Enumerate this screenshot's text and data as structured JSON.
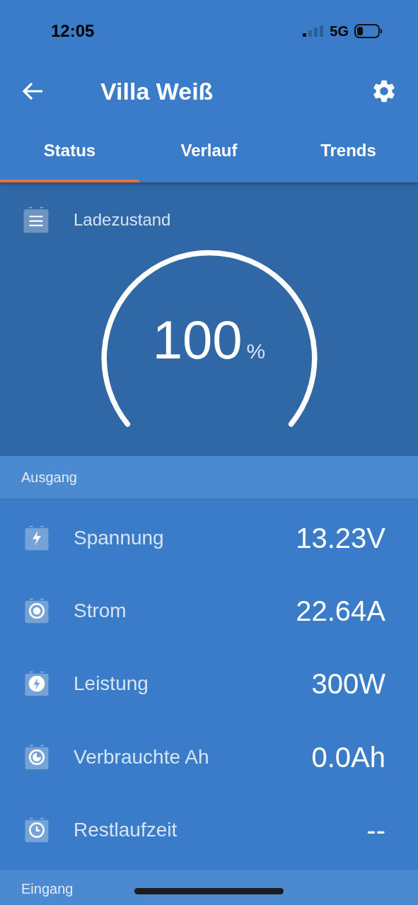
{
  "status_bar": {
    "time": "12:05",
    "network": "5G"
  },
  "header": {
    "title": "Villa Weiß"
  },
  "tabs": [
    {
      "label": "Status",
      "selected": true
    },
    {
      "label": "Verlauf",
      "selected": false
    },
    {
      "label": "Trends",
      "selected": false
    }
  ],
  "gauge": {
    "label": "Ladezustand",
    "value": "100",
    "unit": "%"
  },
  "sections": [
    {
      "title": "Ausgang",
      "rows": [
        {
          "kind": "voltage",
          "label": "Spannung",
          "value": "13.23V"
        },
        {
          "kind": "current",
          "label": "Strom",
          "value": "22.64A"
        },
        {
          "kind": "power",
          "label": "Leistung",
          "value": "300W"
        },
        {
          "kind": "consumed",
          "label": "Verbrauchte Ah",
          "value": "0.0Ah"
        },
        {
          "kind": "time",
          "label": "Restlaufzeit",
          "value": "--"
        }
      ]
    },
    {
      "title": "Eingang"
    }
  ]
}
